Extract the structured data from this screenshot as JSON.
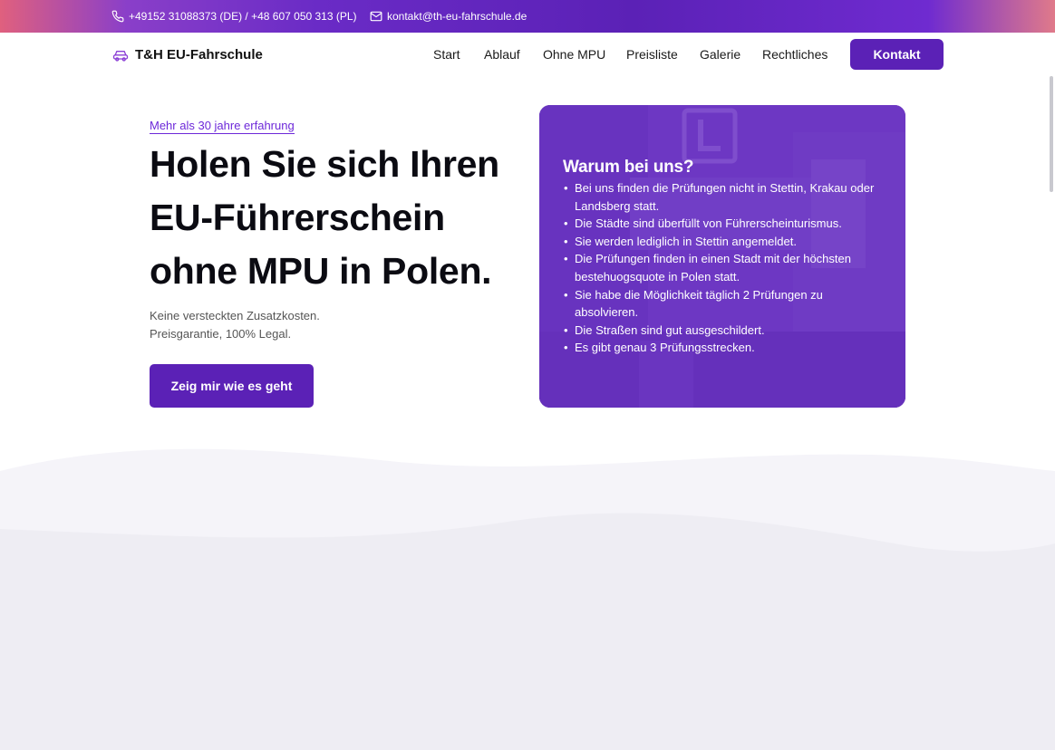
{
  "topbar": {
    "phone_icon": "phone-icon",
    "phone": "+49152 31088373 (DE) / +48 607 050 313 (PL)",
    "mail_icon": "mail-icon",
    "email": "kontakt@th-eu-fahrschule.de"
  },
  "header": {
    "logo_icon": "car-icon",
    "brand": "T&H EU-Fahrschule",
    "nav": [
      "Start",
      "Ablauf",
      "Ohne MPU",
      "Preisliste",
      "Galerie",
      "Rechtliches"
    ],
    "cta_label": "Kontakt"
  },
  "hero": {
    "eyebrow": "Mehr als 30 jahre erfahrung",
    "headline": "Holen Sie sich Ihren EU-Führerschein ohne MPU in Polen.",
    "sub_line1": "Keine versteckten Zusatzkosten.",
    "sub_line2": "Preisgarantie, 100% Legal.",
    "cta_label": "Zeig mir wie es geht"
  },
  "card": {
    "title": "Warum bei uns?",
    "items": [
      "Bei uns finden die Prüfungen nicht in Stettin, Krakau oder Landsberg statt.",
      "Die Städte sind überfüllt von Führerscheinturismus.",
      "Sie werden lediglich in Stettin angemeldet.",
      "Die Prüfungen finden in einen Stadt mit der höchsten bestehuogsquote in Polen statt.",
      "Sie habe die Möglichkeit täglich 2 Prüfungen zu absolvieren.",
      "Die Straßen sind gut ausgeschildert.",
      "Es gibt genau 3 Prüfungsstrecken."
    ]
  },
  "colors": {
    "accent": "#5b21b6",
    "eyebrow": "#6d28d9",
    "wave_light": "#f5f4f9",
    "wave_dark": "#eeedf3"
  }
}
